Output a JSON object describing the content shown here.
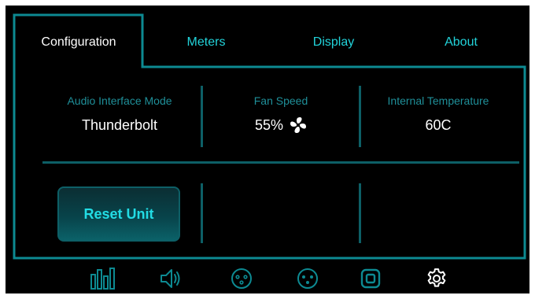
{
  "tabs": [
    {
      "label": "Configuration",
      "active": true
    },
    {
      "label": "Meters",
      "active": false
    },
    {
      "label": "Display",
      "active": false
    },
    {
      "label": "About",
      "active": false
    }
  ],
  "stats": {
    "audio_interface_mode": {
      "label": "Audio Interface Mode",
      "value": "Thunderbolt"
    },
    "fan_speed": {
      "label": "Fan Speed",
      "value": "55%",
      "icon": "fan-icon"
    },
    "internal_temperature": {
      "label": "Internal Temperature",
      "value": "60C"
    }
  },
  "actions": {
    "reset_label": "Reset Unit"
  },
  "bottom_nav": [
    {
      "icon": "meters-icon"
    },
    {
      "icon": "speaker-icon"
    },
    {
      "icon": "xlr-input-icon"
    },
    {
      "icon": "xlr-output-icon"
    },
    {
      "icon": "device-icon"
    },
    {
      "icon": "gear-icon",
      "active": true
    }
  ],
  "colors": {
    "background": "#000000",
    "accent": "#22d3da",
    "outline": "#0d8a92",
    "divider": "#0d5f66",
    "label": "#1f8f99",
    "text": "#ffffff"
  }
}
